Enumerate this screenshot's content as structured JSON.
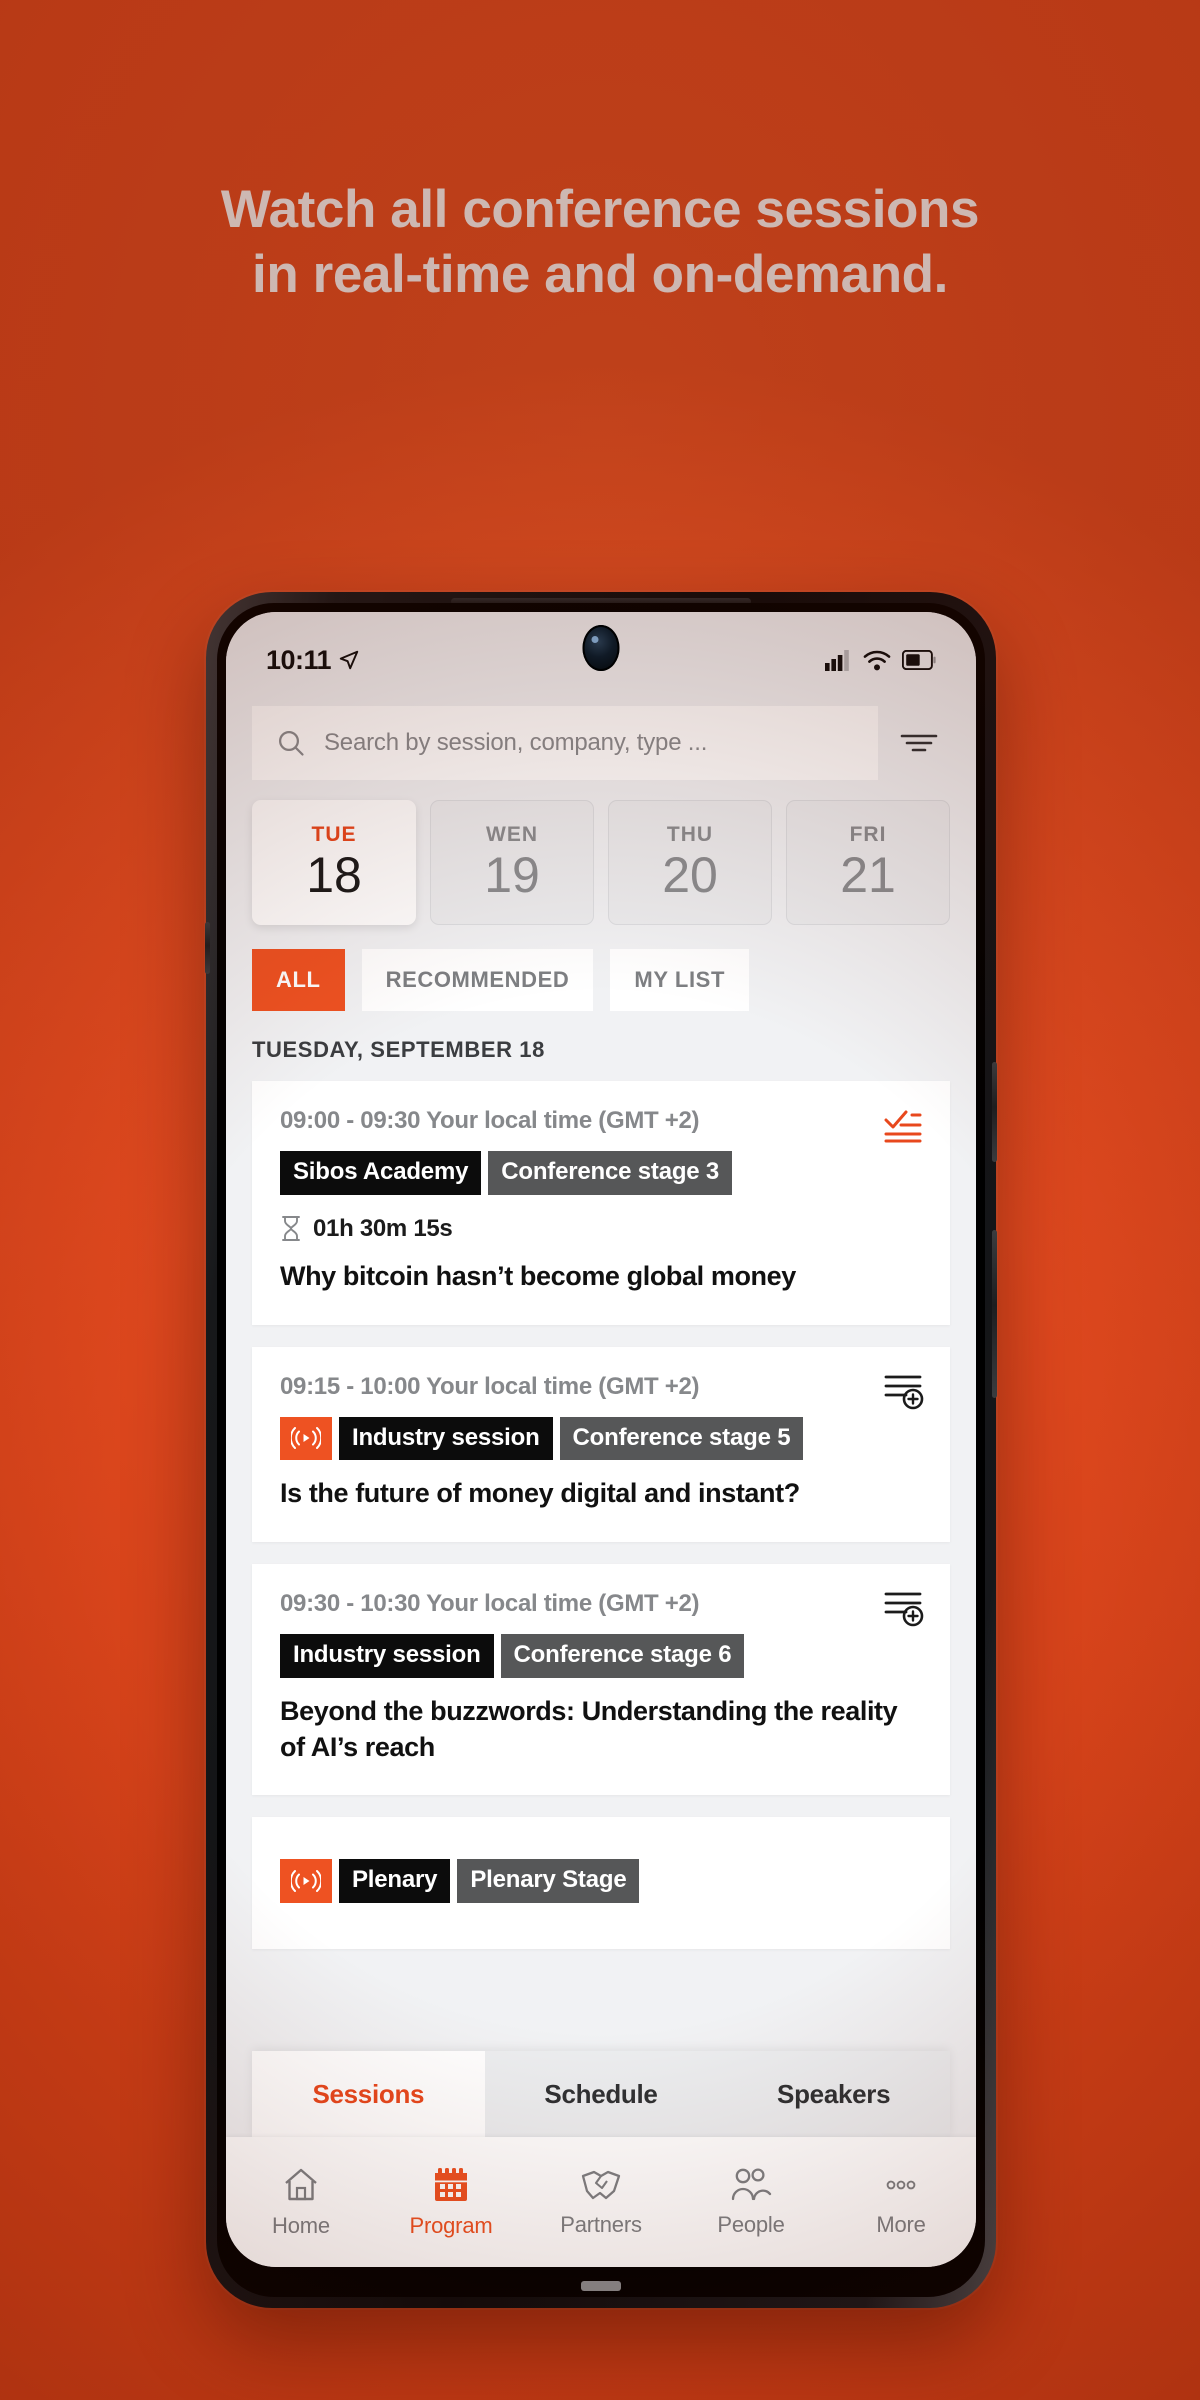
{
  "theme": {
    "brand_orange": "#e44d26",
    "accent_orange": "#ee5222",
    "tag_black": "#0c0c0c",
    "tag_gray": "#565758"
  },
  "headline": {
    "line1": "Watch all conference sessions",
    "line2": "in real-time and on-demand."
  },
  "phone": {
    "status_bar": {
      "time": "10:11",
      "location_icon": "location-arrow-icon",
      "signal_icon": "cellular-signal-icon",
      "wifi_icon": "wifi-icon",
      "battery_icon": "battery-icon"
    },
    "search": {
      "placeholder": "Search by session, company, type ...",
      "search_icon": "search-icon",
      "filter_icon": "filter-icon"
    },
    "dates": [
      {
        "dow": "TUE",
        "day": "18",
        "selected": true
      },
      {
        "dow": "WEN",
        "day": "19",
        "selected": false
      },
      {
        "dow": "THU",
        "day": "20",
        "selected": false
      },
      {
        "dow": "FRI",
        "day": "21",
        "selected": false
      }
    ],
    "chips": [
      {
        "label": "ALL",
        "active": true
      },
      {
        "label": "RECOMMENDED",
        "active": false
      },
      {
        "label": "MY LIST",
        "active": false
      }
    ],
    "day_label": "TUESDAY, SEPTEMBER 18",
    "sessions": [
      {
        "time": "09:00 - 09:30 Your local time (GMT +2)",
        "icon": "checklist-icon",
        "live": false,
        "track": "Sibos Academy",
        "stage": "Conference stage 3",
        "duration": "01h 30m 15s",
        "duration_icon": "hourglass-icon",
        "title": "Why bitcoin hasn’t become global money"
      },
      {
        "time": "09:15 - 10:00 Your local time (GMT +2)",
        "icon": "add-to-list-icon",
        "live": true,
        "live_icon": "live-broadcast-icon",
        "track": "Industry session",
        "stage": "Conference stage 5",
        "duration": "",
        "title": "Is the future of money digital and instant?"
      },
      {
        "time": "09:30 - 10:30 Your local time (GMT +2)",
        "icon": "add-to-list-icon",
        "live": false,
        "track": "Industry session",
        "stage": "Conference stage 6",
        "duration": "",
        "title": "Beyond the buzzwords: Understanding the reality of AI’s reach"
      },
      {
        "time": "",
        "icon": "add-to-list-icon",
        "live": true,
        "live_icon": "live-broadcast-icon",
        "track": "Plenary",
        "stage": "Plenary Stage",
        "duration": "",
        "title": ""
      }
    ],
    "tabs": [
      {
        "label": "Sessions",
        "active": true
      },
      {
        "label": "Schedule",
        "active": false
      },
      {
        "label": "Speakers",
        "active": false
      }
    ],
    "bottom_nav": [
      {
        "label": "Home",
        "icon": "home-icon",
        "active": false
      },
      {
        "label": "Program",
        "icon": "calendar-icon",
        "active": true
      },
      {
        "label": "Partners",
        "icon": "handshake-icon",
        "active": false
      },
      {
        "label": "People",
        "icon": "people-icon",
        "active": false
      },
      {
        "label": "More",
        "icon": "more-dots-icon",
        "active": false
      }
    ]
  }
}
